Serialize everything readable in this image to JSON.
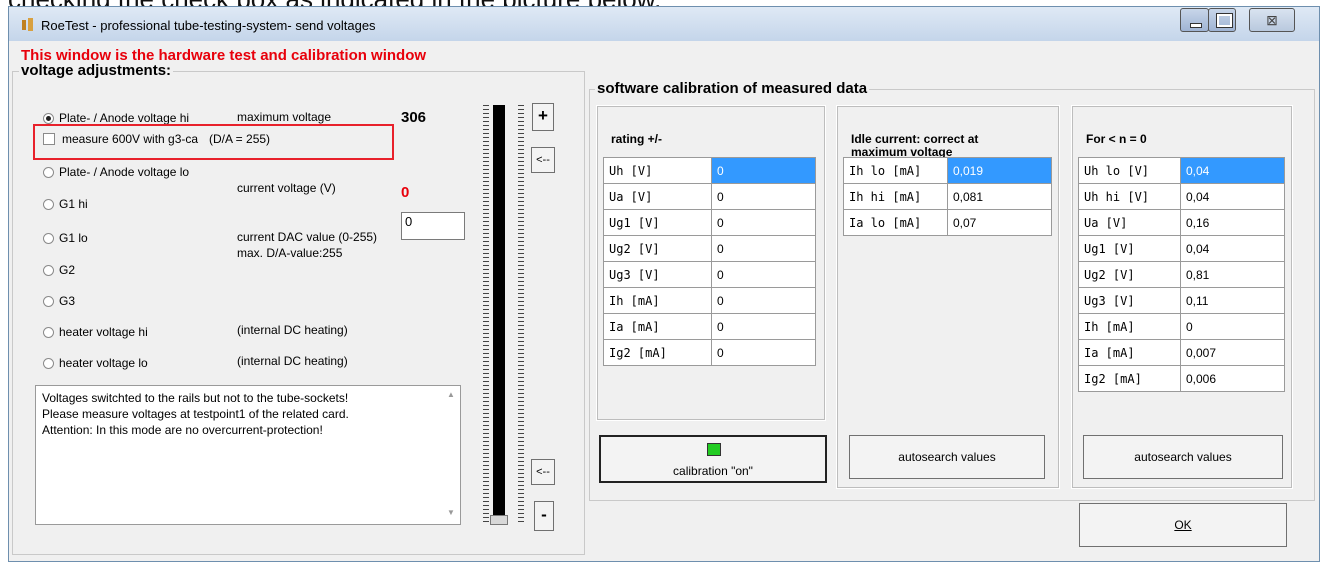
{
  "caption": "checking the check box as indicated in the picture below.",
  "window": {
    "title": "RoeTest - professional tube-testing-system- send voltages",
    "close_glyph": "⊠"
  },
  "warning": "This window is the hardware test and calibration window",
  "voltage": {
    "group_title": "voltage adjustments:",
    "radios": [
      "Plate- / Anode voltage hi",
      "Plate- / Anode voltage lo",
      "G1 hi",
      "G1 lo",
      "G2",
      "G3",
      "heater voltage hi",
      "heater voltage lo"
    ],
    "checkbox_label": "measure 600V with g3-ca",
    "da_note": "(D/A = 255)",
    "max_label": "maximum voltage",
    "max_value": "306",
    "current_voltage_label": "current voltage (V)",
    "current_voltage_value": "0",
    "dac_label": "current DAC value (0-255)",
    "dac_value": "0",
    "max_da": "max. D/A-value:255",
    "heater_note_hi": "(internal DC heating)",
    "heater_note_lo": "(internal DC heating)",
    "memo": "Voltages switchted to the rails but not to the tube-sockets!\nPlease measure voltages at testpoint1 of the related card.\nAttention: In this mode are no overcurrent-protection!",
    "slider_level": 0
  },
  "buttons": {
    "plus": "+",
    "minus": "-",
    "left_top": "<--",
    "left_bottom": "<--",
    "calibration": "calibration \"on\"",
    "autosearch1": "autosearch values",
    "autosearch2": "autosearch values",
    "ok": "OK"
  },
  "software": {
    "group_title": "software calibration of measured data",
    "rating": {
      "title": "rating +/-",
      "rows": [
        [
          "Uh [V]",
          "0"
        ],
        [
          "Ua [V]",
          "0"
        ],
        [
          "Ug1 [V]",
          "0"
        ],
        [
          "Ug2 [V]",
          "0"
        ],
        [
          "Ug3 [V]",
          "0"
        ],
        [
          "Ih [mA]",
          "0"
        ],
        [
          "Ia [mA]",
          "0"
        ],
        [
          "Ig2 [mA]",
          "0"
        ]
      ]
    },
    "idle": {
      "title_line1": "Idle current: correct at",
      "title_line2": "maximum voltage",
      "rows": [
        [
          "Ih lo [mA]",
          "0,019"
        ],
        [
          "Ih hi [mA]",
          "0,081"
        ],
        [
          "Ia lo [mA]",
          "0,07"
        ]
      ]
    },
    "forn": {
      "title": "For < n = 0",
      "rows": [
        [
          "Uh lo [V]",
          "0,04"
        ],
        [
          "Uh hi [V]",
          "0,04"
        ],
        [
          "Ua [V]",
          "0,16"
        ],
        [
          "Ug1 [V]",
          "0,04"
        ],
        [
          "Ug2 [V]",
          "0,81"
        ],
        [
          "Ug3 [V]",
          "0,11"
        ],
        [
          "Ih [mA]",
          "0"
        ],
        [
          "Ia [mA]",
          "0,007"
        ],
        [
          "Ig2 [mA]",
          "0,006"
        ]
      ]
    }
  },
  "colors": {
    "warning": "#e8000b",
    "highlight": "#3399ff",
    "led": "#22cc22"
  }
}
